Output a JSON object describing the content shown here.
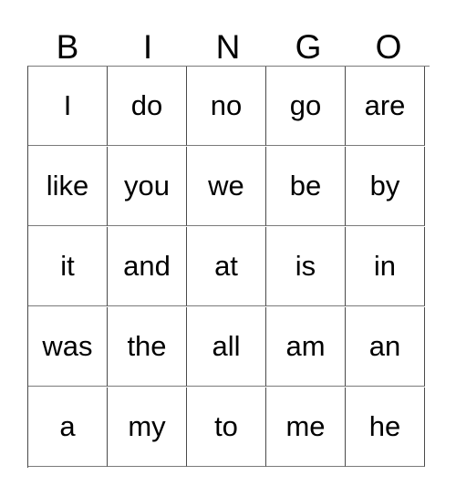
{
  "card": {
    "title": "BINGO",
    "columns": [
      "B",
      "I",
      "N",
      "G",
      "O"
    ],
    "rows": [
      [
        "I",
        "do",
        "no",
        "go",
        "are"
      ],
      [
        "like",
        "you",
        "we",
        "be",
        "by"
      ],
      [
        "it",
        "and",
        "at",
        "is",
        "in"
      ],
      [
        "was",
        "the",
        "all",
        "am",
        "an"
      ],
      [
        "a",
        "my",
        "to",
        "me",
        "he"
      ]
    ],
    "colors": {
      "background": "#ffffff",
      "text": "#000000",
      "cell_border": "#4a4a4a",
      "row_border": "#7a7a7a"
    }
  }
}
